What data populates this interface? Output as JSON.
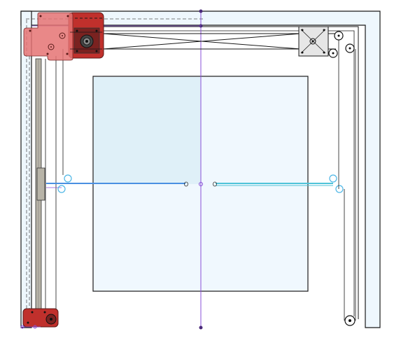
{
  "diagram": {
    "kind": "cad-top-view",
    "colors": {
      "frame_fill": "#eef7fd",
      "frame_stroke": "#1a1a1a",
      "bed_fill": "#f0f8fe",
      "bed_highlight": "#dff0f8",
      "motor_red": "#d9534f",
      "motor_red_dark": "#c0302c",
      "translucent_red": "#e57373",
      "rail_gray": "#b8b4a8",
      "axis_purple": "#8a4fd8",
      "belt_blue": "#4a90e2",
      "belt_cyan": "#4fc3d8",
      "idler_cyan": "#4db6e6"
    },
    "parts": [
      "outer-frame",
      "build-bed",
      "x-motor-mount",
      "idler-bracket",
      "left-linear-rail",
      "carriage-block",
      "bottom-left-bracket",
      "bottom-right-pulley",
      "crossed-belts",
      "x-gantry-belt",
      "center-axis-line"
    ]
  }
}
